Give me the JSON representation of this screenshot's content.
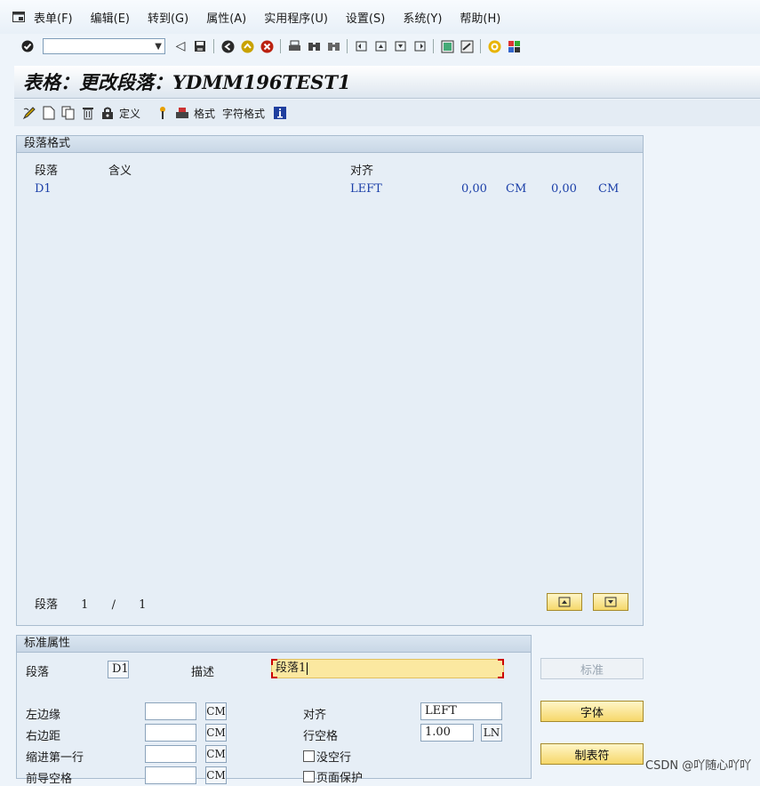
{
  "menu": {
    "items": [
      "表单(F)",
      "编辑(E)",
      "转到(G)",
      "属性(A)",
      "实用程序(U)",
      "设置(S)",
      "系统(Y)",
      "帮助(H)"
    ]
  },
  "window": {
    "title": "表格：更改段落：YDMM196TEST1"
  },
  "app_toolbar": {
    "define_label": "定义",
    "format_label": "格式",
    "char_format_label": "字符格式"
  },
  "para_formats": {
    "section_title": "段落格式",
    "columns": {
      "para": "段落",
      "meaning": "含义",
      "align": "对齐"
    },
    "rows": [
      {
        "para": "D1",
        "meaning": "",
        "align": "LEFT",
        "v1": "0,00",
        "u1": "CM",
        "v2": "0,00",
        "u2": "CM"
      }
    ],
    "pager": {
      "label": "段落",
      "current": "1",
      "sep": "/",
      "total": "1"
    }
  },
  "std_attrs": {
    "section_title": "标准属性",
    "para_label": "段落",
    "para_value": "D1",
    "desc_label": "描述",
    "desc_value": "段落1",
    "left_margin_label": "左边缘",
    "left_margin_value": "",
    "left_margin_unit": "CM",
    "right_margin_label": "右边距",
    "right_margin_value": "",
    "right_margin_unit": "CM",
    "indent_label": "缩进第一行",
    "indent_value": "",
    "indent_unit": "CM",
    "lead_label": "前导空格",
    "lead_value": "",
    "lead_unit": "CM",
    "align_label": "对齐",
    "align_value": "LEFT",
    "spacing_label": "行空格",
    "spacing_value": "1.00",
    "spacing_unit": "LN",
    "no_blank_label": "没空行",
    "page_protect_label": "页面保护"
  },
  "side_buttons": {
    "standard": "标准",
    "font": "字体",
    "tabs": "制表符"
  },
  "watermark": "CSDN @吖随心吖吖"
}
